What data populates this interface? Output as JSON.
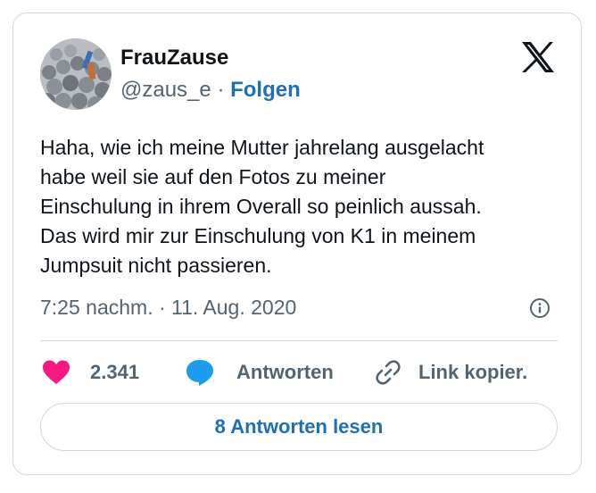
{
  "author": {
    "name": "FrauZause",
    "handle": "@zaus_e",
    "separator": "·",
    "follow_label": "Folgen"
  },
  "tweet": {
    "lines": [
      "Haha, wie ich meine Mutter jahrelang ausgelacht",
      "habe weil sie auf den Fotos zu meiner",
      "Einschulung in ihrem Overall so peinlich aussah.",
      "Das wird mir zur Einschulung von K1 in meinem",
      "Jumpsuit nicht passieren."
    ],
    "timestamp": "7:25 nachm. · 11. Aug. 2020"
  },
  "actions": {
    "like_count": "2.341",
    "reply_label": "Antworten",
    "copy_label": "Link kopier."
  },
  "read_replies_label": "8 Antworten lesen",
  "icons": {
    "logo": "x-logo-icon",
    "info": "info-icon",
    "like": "heart-icon",
    "reply": "speech-bubble-icon",
    "copy": "link-icon"
  },
  "colors": {
    "heart": "#f91880",
    "reply": "#1d9bf0",
    "link": "#1d6fb8",
    "muted": "#536471"
  }
}
